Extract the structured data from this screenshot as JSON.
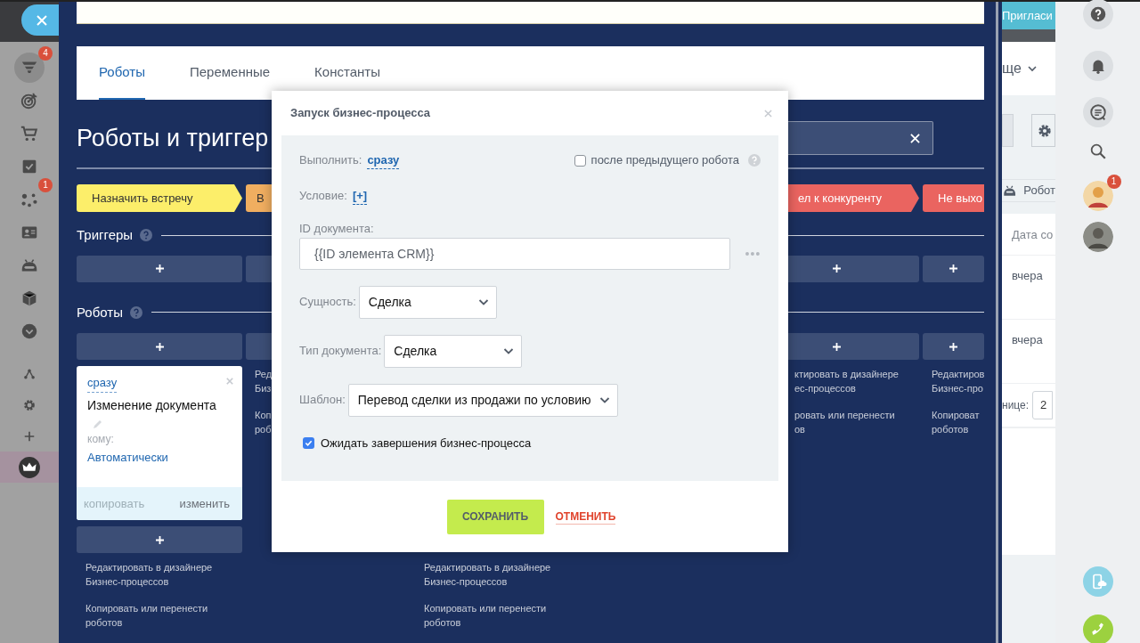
{
  "sidebar": {
    "items": [
      {
        "kind": "funnel",
        "badge": "4",
        "selected": true
      },
      {
        "kind": "target",
        "selected": false
      },
      {
        "kind": "cart",
        "selected": false
      },
      {
        "kind": "task",
        "selected": false
      },
      {
        "kind": "network",
        "badge": "1",
        "selected": false
      },
      {
        "kind": "contact",
        "selected": false
      },
      {
        "kind": "robot",
        "selected": false
      },
      {
        "kind": "box",
        "selected": false
      },
      {
        "kind": "more",
        "selected": false
      }
    ],
    "tools": [
      {
        "kind": "sitemap",
        "selected": false
      },
      {
        "kind": "gear",
        "selected": false
      },
      {
        "kind": "plus",
        "selected": false
      },
      {
        "kind": "crown",
        "selected": true
      }
    ]
  },
  "panel": {
    "tabs": [
      {
        "label": "Роботы",
        "selected": true
      },
      {
        "label": "Переменные",
        "selected": false
      },
      {
        "label": "Константы",
        "selected": false
      }
    ],
    "title": "Роботы и триггер",
    "stages": [
      {
        "label": "Назначить встречу",
        "color": "#fcee6a"
      },
      {
        "label": "В",
        "color": "#f0ae60"
      },
      {
        "label": "ел к конкуренту",
        "color": "#ea6460"
      },
      {
        "label": "Не выхо",
        "color": "#ea6460"
      }
    ],
    "triggers_heading": "Триггеры",
    "robots_heading": "Роботы",
    "columns": [
      {
        "kind": "robot",
        "robot": {
          "delay": "сразу",
          "title": "Изменение документа",
          "to_label": "кому:",
          "to_value": "Автоматически",
          "actions": [
            {
              "label": "копировать",
              "disabled": true
            },
            {
              "label": "изменить",
              "disabled": false
            }
          ]
        },
        "links": [
          [
            "Редактировать в дизайнере",
            "Бизнес-процессов"
          ],
          [
            "Копировать или перенести",
            "роботов"
          ]
        ]
      },
      {
        "kind": "links",
        "links": [
          [
            "Ред",
            "Биз"
          ],
          [
            "Коп",
            "роб"
          ]
        ]
      },
      {
        "kind": "hidden_robot",
        "links": [
          [
            "Редактировать в дизайнере",
            "Бизнес-процессов"
          ],
          [
            "Копировать или перенести",
            "роботов"
          ]
        ]
      },
      {
        "kind": "links",
        "links": [
          [
            "ктировать в дизайнере",
            "ес-процессов"
          ],
          [
            "ровать или перенести",
            "ов"
          ]
        ]
      },
      {
        "kind": "links",
        "links": [
          [
            "Редактиров",
            "Бизнес-про"
          ],
          [
            "Копироват",
            "роботов"
          ]
        ]
      }
    ]
  },
  "crm": {
    "invite": "Пригласи",
    "menu": "ще",
    "tab": "Робот",
    "column_header": "Дата со",
    "rows": [
      "вчера",
      "вчера"
    ],
    "pager_label": "нице:",
    "pager_value": "2"
  },
  "right_bar": {
    "items": [
      {
        "kind": "help"
      },
      {
        "kind": "bell"
      },
      {
        "kind": "chat"
      },
      {
        "kind": "search"
      },
      {
        "kind": "avatar",
        "badge": "1"
      },
      {
        "kind": "avatar"
      }
    ],
    "bottom": [
      {
        "kind": "cloud-phone"
      },
      {
        "kind": "call"
      }
    ]
  },
  "modal": {
    "title": "Запуск бизнес-процесса",
    "run_label": "Выполнить:",
    "run_value": "сразу",
    "after_previous": {
      "label": "после предыдущего робота",
      "checked": false
    },
    "condition_label": "Условие:",
    "condition_value": "[+]",
    "document_id": {
      "label": "ID документа:",
      "value": "{{ID элемента CRM}}"
    },
    "selects": [
      {
        "label": "Сущность:",
        "value": "Сделка"
      },
      {
        "label": "Тип документа:",
        "value": "Сделка"
      },
      {
        "label": "Шаблон:",
        "value": "Перевод сделки из продажи по условию"
      }
    ],
    "wait": {
      "label": "Ожидать завершения бизнес-процесса",
      "checked": true
    },
    "save": "СОХРАНИТЬ",
    "cancel": "ОТМЕНИТЬ"
  }
}
